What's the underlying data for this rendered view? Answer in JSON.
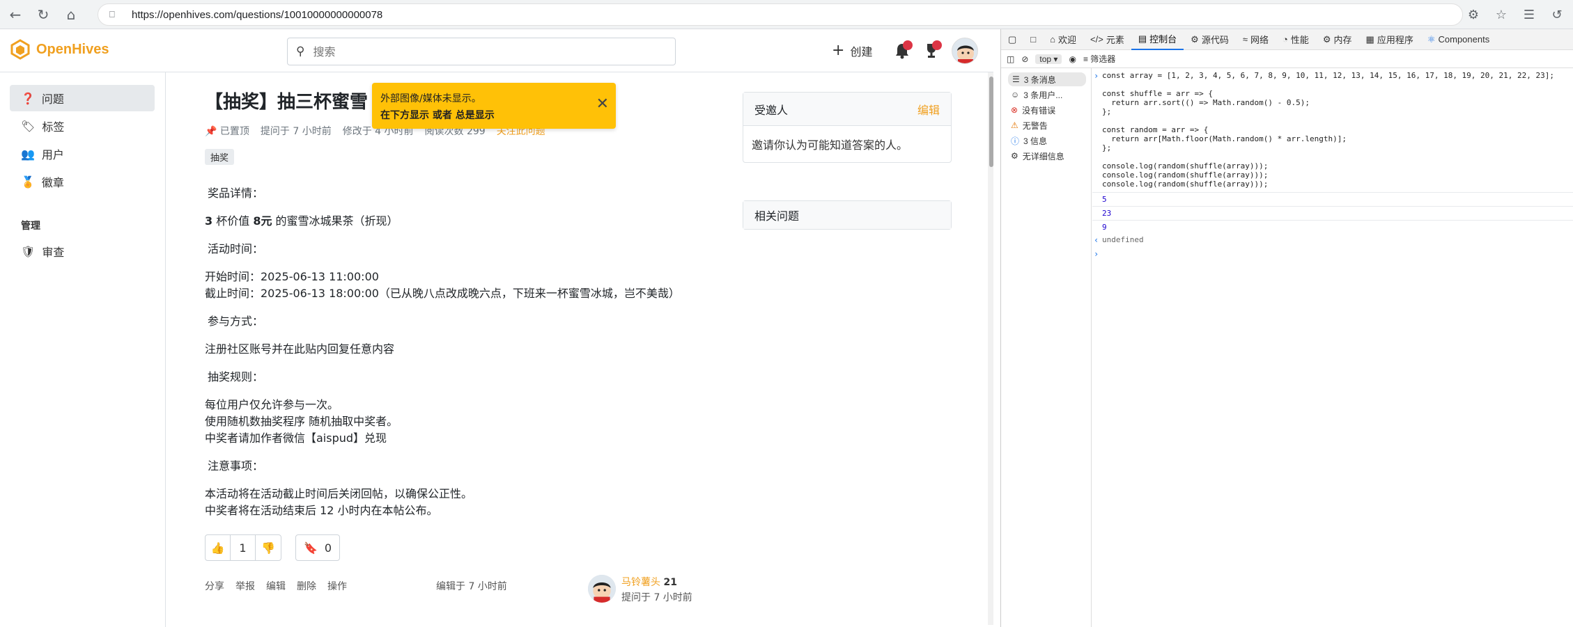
{
  "browser": {
    "url": "https://openhives.com/questions/10010000000000078"
  },
  "header": {
    "logo_text": "OpenHives",
    "search_placeholder": "搜索",
    "create_label": "创建"
  },
  "sidebar": {
    "items": [
      {
        "label": "问题"
      },
      {
        "label": "标签"
      },
      {
        "label": "用户"
      },
      {
        "label": "徽章"
      }
    ],
    "admin_heading": "管理",
    "admin_items": [
      {
        "label": "审查"
      }
    ]
  },
  "question": {
    "title": "【抽奖】抽三杯蜜雪",
    "meta": {
      "pinned": "已置顶",
      "asked": "提问于 7 小时前",
      "modified": "修改于 4 小时前",
      "views": "阅读次数 299",
      "follow": "关注此问题"
    },
    "tag": "抽奖",
    "body": {
      "prize_head": "奖品详情：",
      "prize_a": "3",
      "prize_b": " 杯价值 ",
      "prize_c": "8元",
      "prize_d": " 的蜜雪冰城果茶（折现）",
      "time_head": "活动时间：",
      "start": "开始时间：2025-06-13 11:00:00",
      "end": "截止时间：2025-06-13 18:00:00（已从晚八点改成晚六点，下班来一杯蜜雪冰城，岂不美哉）",
      "join_head": "参与方式：",
      "join": "注册社区账号并在此贴内回复任意内容",
      "rule_head": "抽奖规则：",
      "rule1": "每位用户仅允许参与一次。",
      "rule2": "使用随机数抽奖程序 随机抽取中奖者。",
      "rule3": "中奖者请加作者微信【aispud】兑现",
      "note_head": "注意事项：",
      "note1": "本活动将在活动截止时间后关闭回帖，以确保公正性。",
      "note2": "中奖者将在活动结束后 12 小时内在本帖公布。"
    },
    "votes": "1",
    "bookmarks": "0",
    "actions": [
      "分享",
      "举报",
      "编辑",
      "删除",
      "操作"
    ],
    "edited": "编辑于 7 小时前",
    "author": {
      "name": "马铃薯头",
      "reputation": "21",
      "asked": "提问于 7 小时前"
    }
  },
  "toast": {
    "line1": "外部图像/媒体未显示。",
    "line2": "在下方显示 或者 总是显示"
  },
  "invitees": {
    "title": "受邀人",
    "edit": "编辑",
    "body": "邀请你认为可能知道答案的人。"
  },
  "related": {
    "title": "相关问题"
  },
  "devtools": {
    "tabs": [
      "欢迎",
      "元素",
      "控制台",
      "源代码",
      "网络",
      "性能",
      "内存",
      "应用程序",
      "Components"
    ],
    "context": "top",
    "filter_placeholder": "筛选器",
    "side": [
      "3 条消息",
      "3 条用户...",
      "没有错误",
      "无警告",
      "3 信息",
      "无详细信息"
    ],
    "code": [
      "const array = [1, 2, 3, 4, 5, 6, 7, 8, 9, 10, 11, 12, 13, 14, 15, 16, 17, 18, 19, 20, 21, 22, 23];",
      "",
      "const shuffle = arr => {",
      "  return arr.sort(() => Math.random() - 0.5);",
      "};",
      "",
      "const random = arr => {",
      "  return arr[Math.floor(Math.random() * arr.length)];",
      "};",
      "",
      "console.log(random(shuffle(array)));",
      "console.log(random(shuffle(array)));",
      "console.log(random(shuffle(array)));"
    ],
    "outputs": [
      "5",
      "23",
      "9"
    ],
    "return_value": "undefined"
  }
}
